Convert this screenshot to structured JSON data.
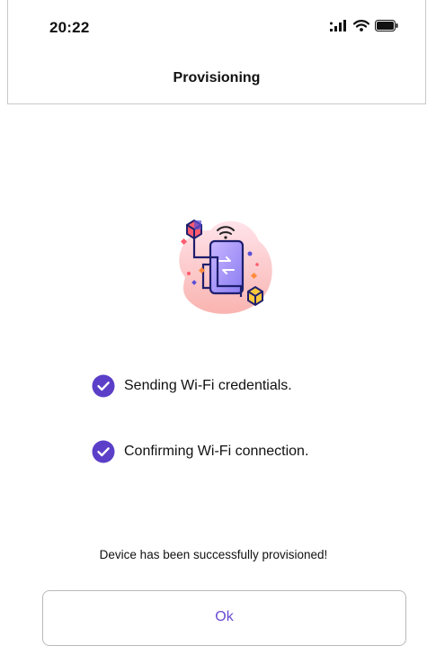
{
  "status_bar": {
    "time": "20:22"
  },
  "header": {
    "title": "Provisioning"
  },
  "illustration": {
    "icon": "device-provisioning-illustration"
  },
  "steps": [
    {
      "label": "Sending Wi-Fi credentials.",
      "status": "completed",
      "icon": "check-circle-icon"
    },
    {
      "label": "Confirming Wi-Fi connection.",
      "status": "completed",
      "icon": "check-circle-icon"
    }
  ],
  "message": "Device has been successfully provisioned!",
  "ok_button": {
    "label": "Ok"
  },
  "colors": {
    "accent": "#6a4bd1",
    "check": "#5b3fc8"
  }
}
